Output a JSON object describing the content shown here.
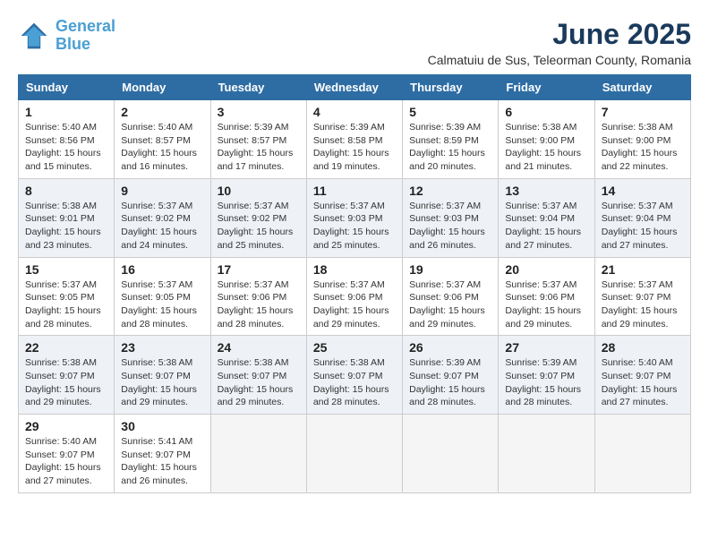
{
  "header": {
    "logo_line1": "General",
    "logo_line2": "Blue",
    "title": "June 2025",
    "subtitle": "Calmatuiu de Sus, Teleorman County, Romania"
  },
  "columns": [
    "Sunday",
    "Monday",
    "Tuesday",
    "Wednesday",
    "Thursday",
    "Friday",
    "Saturday"
  ],
  "weeks": [
    [
      {
        "day": "1",
        "sunrise": "Sunrise: 5:40 AM",
        "sunset": "Sunset: 8:56 PM",
        "daylight": "Daylight: 15 hours and 15 minutes."
      },
      {
        "day": "2",
        "sunrise": "Sunrise: 5:40 AM",
        "sunset": "Sunset: 8:57 PM",
        "daylight": "Daylight: 15 hours and 16 minutes."
      },
      {
        "day": "3",
        "sunrise": "Sunrise: 5:39 AM",
        "sunset": "Sunset: 8:57 PM",
        "daylight": "Daylight: 15 hours and 17 minutes."
      },
      {
        "day": "4",
        "sunrise": "Sunrise: 5:39 AM",
        "sunset": "Sunset: 8:58 PM",
        "daylight": "Daylight: 15 hours and 19 minutes."
      },
      {
        "day": "5",
        "sunrise": "Sunrise: 5:39 AM",
        "sunset": "Sunset: 8:59 PM",
        "daylight": "Daylight: 15 hours and 20 minutes."
      },
      {
        "day": "6",
        "sunrise": "Sunrise: 5:38 AM",
        "sunset": "Sunset: 9:00 PM",
        "daylight": "Daylight: 15 hours and 21 minutes."
      },
      {
        "day": "7",
        "sunrise": "Sunrise: 5:38 AM",
        "sunset": "Sunset: 9:00 PM",
        "daylight": "Daylight: 15 hours and 22 minutes."
      }
    ],
    [
      {
        "day": "8",
        "sunrise": "Sunrise: 5:38 AM",
        "sunset": "Sunset: 9:01 PM",
        "daylight": "Daylight: 15 hours and 23 minutes."
      },
      {
        "day": "9",
        "sunrise": "Sunrise: 5:37 AM",
        "sunset": "Sunset: 9:02 PM",
        "daylight": "Daylight: 15 hours and 24 minutes."
      },
      {
        "day": "10",
        "sunrise": "Sunrise: 5:37 AM",
        "sunset": "Sunset: 9:02 PM",
        "daylight": "Daylight: 15 hours and 25 minutes."
      },
      {
        "day": "11",
        "sunrise": "Sunrise: 5:37 AM",
        "sunset": "Sunset: 9:03 PM",
        "daylight": "Daylight: 15 hours and 25 minutes."
      },
      {
        "day": "12",
        "sunrise": "Sunrise: 5:37 AM",
        "sunset": "Sunset: 9:03 PM",
        "daylight": "Daylight: 15 hours and 26 minutes."
      },
      {
        "day": "13",
        "sunrise": "Sunrise: 5:37 AM",
        "sunset": "Sunset: 9:04 PM",
        "daylight": "Daylight: 15 hours and 27 minutes."
      },
      {
        "day": "14",
        "sunrise": "Sunrise: 5:37 AM",
        "sunset": "Sunset: 9:04 PM",
        "daylight": "Daylight: 15 hours and 27 minutes."
      }
    ],
    [
      {
        "day": "15",
        "sunrise": "Sunrise: 5:37 AM",
        "sunset": "Sunset: 9:05 PM",
        "daylight": "Daylight: 15 hours and 28 minutes."
      },
      {
        "day": "16",
        "sunrise": "Sunrise: 5:37 AM",
        "sunset": "Sunset: 9:05 PM",
        "daylight": "Daylight: 15 hours and 28 minutes."
      },
      {
        "day": "17",
        "sunrise": "Sunrise: 5:37 AM",
        "sunset": "Sunset: 9:06 PM",
        "daylight": "Daylight: 15 hours and 28 minutes."
      },
      {
        "day": "18",
        "sunrise": "Sunrise: 5:37 AM",
        "sunset": "Sunset: 9:06 PM",
        "daylight": "Daylight: 15 hours and 29 minutes."
      },
      {
        "day": "19",
        "sunrise": "Sunrise: 5:37 AM",
        "sunset": "Sunset: 9:06 PM",
        "daylight": "Daylight: 15 hours and 29 minutes."
      },
      {
        "day": "20",
        "sunrise": "Sunrise: 5:37 AM",
        "sunset": "Sunset: 9:06 PM",
        "daylight": "Daylight: 15 hours and 29 minutes."
      },
      {
        "day": "21",
        "sunrise": "Sunrise: 5:37 AM",
        "sunset": "Sunset: 9:07 PM",
        "daylight": "Daylight: 15 hours and 29 minutes."
      }
    ],
    [
      {
        "day": "22",
        "sunrise": "Sunrise: 5:38 AM",
        "sunset": "Sunset: 9:07 PM",
        "daylight": "Daylight: 15 hours and 29 minutes."
      },
      {
        "day": "23",
        "sunrise": "Sunrise: 5:38 AM",
        "sunset": "Sunset: 9:07 PM",
        "daylight": "Daylight: 15 hours and 29 minutes."
      },
      {
        "day": "24",
        "sunrise": "Sunrise: 5:38 AM",
        "sunset": "Sunset: 9:07 PM",
        "daylight": "Daylight: 15 hours and 29 minutes."
      },
      {
        "day": "25",
        "sunrise": "Sunrise: 5:38 AM",
        "sunset": "Sunset: 9:07 PM",
        "daylight": "Daylight: 15 hours and 28 minutes."
      },
      {
        "day": "26",
        "sunrise": "Sunrise: 5:39 AM",
        "sunset": "Sunset: 9:07 PM",
        "daylight": "Daylight: 15 hours and 28 minutes."
      },
      {
        "day": "27",
        "sunrise": "Sunrise: 5:39 AM",
        "sunset": "Sunset: 9:07 PM",
        "daylight": "Daylight: 15 hours and 28 minutes."
      },
      {
        "day": "28",
        "sunrise": "Sunrise: 5:40 AM",
        "sunset": "Sunset: 9:07 PM",
        "daylight": "Daylight: 15 hours and 27 minutes."
      }
    ],
    [
      {
        "day": "29",
        "sunrise": "Sunrise: 5:40 AM",
        "sunset": "Sunset: 9:07 PM",
        "daylight": "Daylight: 15 hours and 27 minutes."
      },
      {
        "day": "30",
        "sunrise": "Sunrise: 5:41 AM",
        "sunset": "Sunset: 9:07 PM",
        "daylight": "Daylight: 15 hours and 26 minutes."
      },
      null,
      null,
      null,
      null,
      null
    ]
  ]
}
